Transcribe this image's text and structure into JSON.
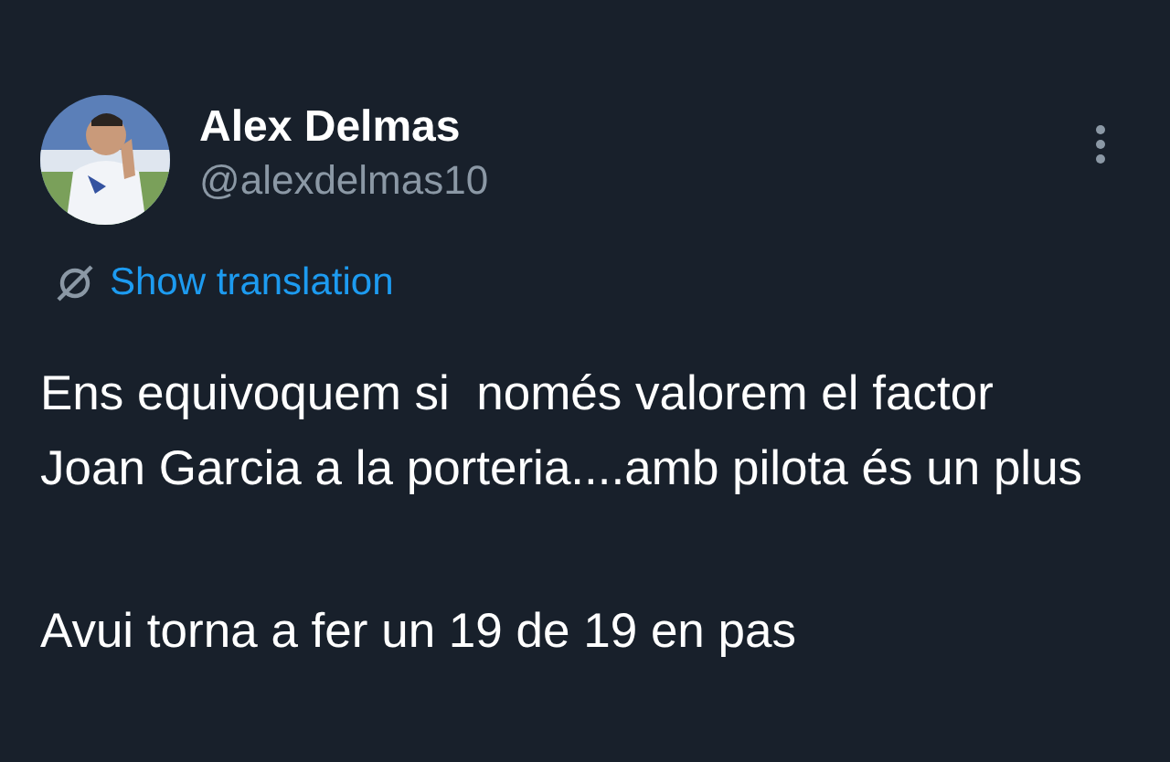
{
  "author": {
    "name": "Alex Delmas",
    "handle": "@alexdelmas10"
  },
  "translation_link": "Show translation",
  "paragraphs": [
    "Ens equivoquem si  només valorem el factor Joan Garcia a la porteria....amb pilota és un plus",
    "Avui torna a fer un 19 de 19 en pas"
  ]
}
